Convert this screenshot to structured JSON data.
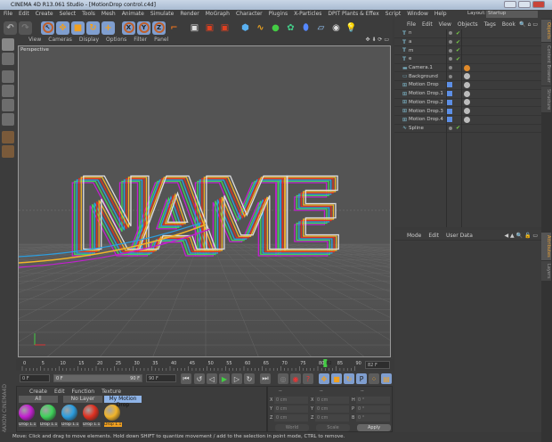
{
  "window": {
    "title": "CINEMA 4D R13.061 Studio - [MotionDrop control.c4d]"
  },
  "menu": [
    "File",
    "Edit",
    "Create",
    "Select",
    "Tools",
    "Mesh",
    "Animate",
    "Simulate",
    "Render",
    "MoGraph",
    "Character",
    "Plugins",
    "X-Particles",
    "DPIT Plants & Effex",
    "Script",
    "Window",
    "Help"
  ],
  "layout": {
    "label": "Layout:",
    "value": "Startup"
  },
  "viewport": {
    "menu": [
      "View",
      "Cameras",
      "Display",
      "Options",
      "Filter",
      "Panel"
    ],
    "label": "Perspective",
    "scene_text": "NAME"
  },
  "timeline": {
    "ticks": [
      "0",
      "5",
      "10",
      "15",
      "20",
      "25",
      "30",
      "35",
      "40",
      "45",
      "50",
      "55",
      "60",
      "65",
      "70",
      "75",
      "80",
      "82",
      "85",
      "90"
    ],
    "current_frame": "82 F",
    "start": "0 F",
    "slider_start": "0 F",
    "slider_end": "90 F",
    "end": "90 F"
  },
  "materials": {
    "menu": [
      "Create",
      "Edit",
      "Function",
      "Texture"
    ],
    "layers": [
      "All",
      "No Layer",
      "My Motion Drop"
    ],
    "items": [
      {
        "name": "Drop 1.1",
        "color": "#c31fd0"
      },
      {
        "name": "Drop 1.1",
        "color": "#3fd35a"
      },
      {
        "name": "Drop 1.1",
        "color": "#2c9ee0"
      },
      {
        "name": "Drop 1.1",
        "color": "#e03020"
      },
      {
        "name": "Drop 1.1",
        "color": "#f2b52a"
      }
    ]
  },
  "coords": {
    "headers": [
      "--",
      "--",
      "--"
    ],
    "rows": [
      {
        "a": "X",
        "av": "0 cm",
        "b": "X",
        "bv": "0 cm",
        "c": "H",
        "cv": "0 °"
      },
      {
        "a": "Y",
        "av": "0 cm",
        "b": "Y",
        "bv": "0 cm",
        "c": "P",
        "cv": "0 °"
      },
      {
        "a": "Z",
        "av": "0 cm",
        "b": "Z",
        "bv": "0 cm",
        "c": "B",
        "cv": "0 °"
      }
    ],
    "mode": "World",
    "type": "Scale",
    "apply": "Apply"
  },
  "status": "Move: Click and drag to move elements. Hold down SHIFT to quantize movement / add to the selection in point mode, CTRL to remove.",
  "objects": {
    "menu": [
      "File",
      "Edit",
      "View",
      "Objects",
      "Tags",
      "Book"
    ],
    "items": [
      {
        "name": "n",
        "type": "text"
      },
      {
        "name": "a",
        "type": "text"
      },
      {
        "name": "m",
        "type": "text"
      },
      {
        "name": "e",
        "type": "text"
      },
      {
        "name": "Camera.1",
        "type": "camera"
      },
      {
        "name": "Background",
        "type": "background"
      },
      {
        "name": "Motion Drop",
        "type": "motiondrop"
      },
      {
        "name": "Motion Drop.1",
        "type": "motiondrop"
      },
      {
        "name": "Motion Drop.2",
        "type": "motiondrop"
      },
      {
        "name": "Motion Drop.3",
        "type": "motiondrop"
      },
      {
        "name": "Motion Drop.4",
        "type": "motiondrop"
      },
      {
        "name": "Spline",
        "type": "spline"
      }
    ]
  },
  "attributes": {
    "menu": [
      "Mode",
      "Edit",
      "User Data"
    ]
  },
  "side_tabs": [
    "Objects",
    "Content Browser",
    "Structure",
    "Attributes",
    "Layers"
  ],
  "branding": "MAXON CINEMA4D"
}
